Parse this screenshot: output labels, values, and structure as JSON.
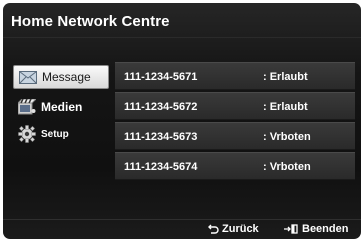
{
  "window": {
    "title": "Home Network Centre"
  },
  "menu": {
    "items": [
      {
        "label": "Message",
        "icon": "envelope-icon",
        "selected": true
      },
      {
        "label": "Medien",
        "icon": "media-icon",
        "selected": false
      },
      {
        "label": "Setup",
        "icon": "gear-icon",
        "selected": false
      }
    ]
  },
  "devices": [
    {
      "number": "111-1234-5671",
      "status": ": Erlaubt"
    },
    {
      "number": "111-1234-5672",
      "status": ": Erlaubt"
    },
    {
      "number": "111-1234-5673",
      "status": ": Vrboten"
    },
    {
      "number": "111-1234-5674",
      "status": ": Vrboten"
    }
  ],
  "footer": {
    "back_label": "Zurück",
    "back_icon": "return-icon",
    "exit_label": "Beenden",
    "exit_icon": "exit-icon"
  },
  "colors": {
    "panel_background": "#151515",
    "row_background": "#333333",
    "selected_background": "#ececec",
    "text": "#ffffff"
  }
}
